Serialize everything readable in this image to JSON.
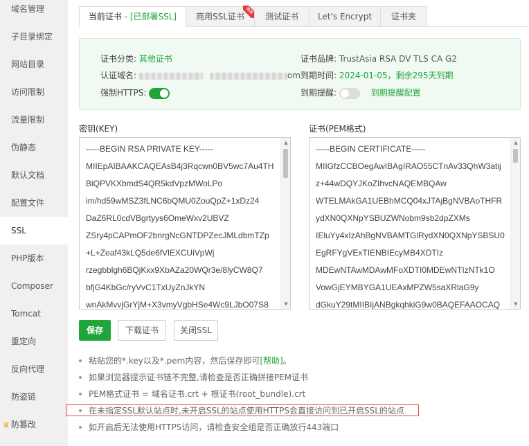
{
  "sidebar": {
    "items": [
      {
        "label": "域名管理"
      },
      {
        "label": "子目录绑定"
      },
      {
        "label": "网站目录"
      },
      {
        "label": "访问限制"
      },
      {
        "label": "流量限制"
      },
      {
        "label": "伪静态"
      },
      {
        "label": "默认文档"
      },
      {
        "label": "配置文件"
      },
      {
        "label": "SSL",
        "active": true
      },
      {
        "label": "PHP版本"
      },
      {
        "label": "Composer"
      },
      {
        "label": "Tomcat"
      },
      {
        "label": "重定向"
      },
      {
        "label": "反向代理"
      },
      {
        "label": "防盗链"
      },
      {
        "label": "防篡改"
      }
    ]
  },
  "tabs": {
    "current_prefix": "当前证书 - ",
    "current_status": "[已部署SSL]",
    "commercial": "商用SSL证书",
    "commercial_badge": "推荐",
    "test": "测试证书",
    "letsencrypt": "Let's Encrypt",
    "folder": "证书夹"
  },
  "cert_info": {
    "category_label": "证书分类:",
    "category_value": "其他证书",
    "domain_label": "认证域名:",
    "domain_suffix": "om",
    "force_https_label": "强制HTTPS:",
    "force_https_on": true,
    "brand_label": "证书品牌:",
    "brand_value": "TrustAsia RSA DV TLS CA G2",
    "expire_label": "到期时间:",
    "expire_value": "2024-01-05，剩余295天到期",
    "remind_label": "到期提醒:",
    "remind_on": false,
    "remind_link": "到期提醒配置"
  },
  "key_area": {
    "label": "密钥(KEY)",
    "lines": [
      "-----BEGIN RSA PRIVATE KEY-----",
      "MIIEpAIBAAKCAQEAsB4j3Rqcwn0BV5wc7Au4TH",
      "BiQPVKXbmdS4QR5kdVpzMWoLPo",
      "im/hd59wMSZ3fLNC6bQMU0ZouQpZ+1xDz24",
      "DaZ6RL0cdVBgrtyys6OmeWxv2UBVZ",
      "ZSry4pCAPmOF2bnrgNcGNTDPZecJMLdbmTZp",
      "+L+Zeaf43kLQ5de6fVlEXCUiVpWj",
      "rzegbblgh6BQjKxx9XbAZa20WQr3e/8lyCW8Q7",
      "bfjG4KbGc/ryVvC1TxUyZnJkYN",
      "wnAkMvvjGrYjM+X3vmyVgbHSe4Wc9LJbO07S8"
    ]
  },
  "cert_area": {
    "label": "证书(PEM格式)",
    "lines": [
      "-----BEGIN CERTIFICATE-----",
      "MIIGfzCCBOegAwIBAgIRAO55CTnAv33QhW3atij",
      "z+44wDQYJKoZIhvcNAQEMBQAw",
      "WTELMAkGA1UEBhMCQ04xJTAjBgNVBAoTHFR",
      "ydXN0QXNpYSBUZWNobm9sb2dpZXMs",
      "IEluYy4xIzAhBgNVBAMTGlRydXN0QXNpYSBSU0",
      "EgRFYgVExTIENBIEcyMB4XDTIz",
      "MDEwNTAwMDAwMFoXDTI0MDEwNTIzNTk1O",
      "VowGjEYMBYGA1UEAxMPZW5saXRlaG9y",
      "dGkuY29tMIIBIjANBgkqhkiG9w0BAQEFAAOCAQ"
    ]
  },
  "buttons": {
    "save": "保存",
    "download": "下载证书",
    "close": "关闭SSL"
  },
  "help": {
    "line1_pre": "粘贴您的*.key以及*.pem内容，然后保存即可",
    "line1_link": "[帮助]",
    "line1_post": "。",
    "line2": "如果浏览器提示证书链不完整,请检查是否正确拼接PEM证书",
    "line3": "PEM格式证书 = 域名证书.crt + 根证书(root_bundle).crt",
    "line4": "在未指定SSL默认站点时,未开启SSL的站点使用HTTPS会直接访问到已开启SSL的站点",
    "line5": "如开启后无法使用HTTPS访问，请检查安全组是否正确放行443端口"
  },
  "colors": {
    "accent": "#20a53a",
    "alert_border": "#e24a4a",
    "panel_bg": "#f1f9f3"
  }
}
